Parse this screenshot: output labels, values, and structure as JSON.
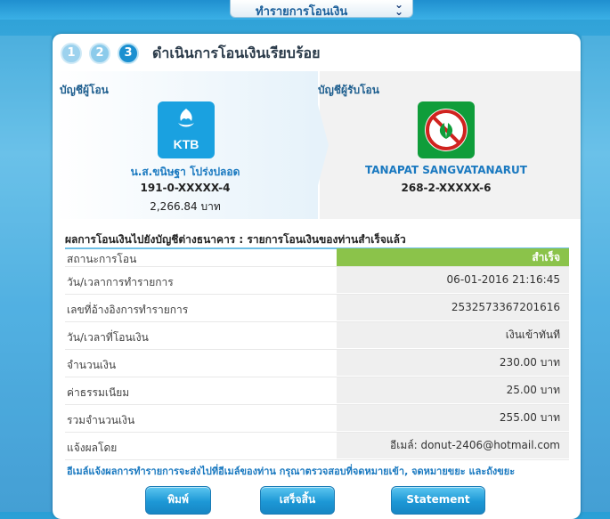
{
  "header": {
    "dropdown_label": "ทำรายการโอนเงิน",
    "dropdown_icon": "double-chevron-down-icon"
  },
  "steps": {
    "step1": "1",
    "step2": "2",
    "step3": "3",
    "title": "ดำเนินการโอนเงินเรียบร้อย"
  },
  "from": {
    "label": "บัญชีผู้โอน",
    "bank_logo_text": "KTB",
    "name": "น.ส.ขนิษฐา โปร่งปลอด",
    "account": "191-0-XXXXX-4",
    "balance": "2,266.84 บาท"
  },
  "to": {
    "label": "บัญชีผู้รับโอน",
    "name": "TANAPAT SANGVATANARUT",
    "account": "268-2-XXXXX-6"
  },
  "result": {
    "heading": "ผลการโอนเงินไปยังบัญชีต่างธนาคาร : รายการโอนเงินของท่านสำเร็จแล้ว",
    "rows": [
      {
        "label": "สถานะการโอน",
        "value": "สำเร็จ"
      },
      {
        "label": "วัน/เวลาการทำรายการ",
        "value": "06-01-2016 21:16:45"
      },
      {
        "label": "เลขที่อ้างอิงการทำรายการ",
        "value": "2532573367201616"
      },
      {
        "label": "วัน/เวลาที่โอนเงิน",
        "value": "เงินเข้าทันที"
      },
      {
        "label": "จำนวนเงิน",
        "value": "230.00 บาท"
      },
      {
        "label": "ค่าธรรมเนียม",
        "value": "25.00 บาท"
      },
      {
        "label": "รวมจำนวนเงิน",
        "value": "255.00 บาท"
      },
      {
        "label": "แจ้งผลโดย",
        "value": "อีเมล์: donut-2406@hotmail.com"
      }
    ]
  },
  "note": "อีเมล์แจ้งผลการทำรายการจะส่งไปที่อีเมล์ของท่าน กรุณาตรวจสอบที่จดหมายเข้า, จดหมายขยะ และถังขยะ",
  "buttons": {
    "print": "พิมพ์",
    "finish": "เสร็จสิ้น",
    "statement": "Statement"
  },
  "colors": {
    "success": "#8bc34a",
    "accent": "#1a8fd0",
    "ktb": "#1aa1e0",
    "kbank": "#0f9d3a"
  }
}
